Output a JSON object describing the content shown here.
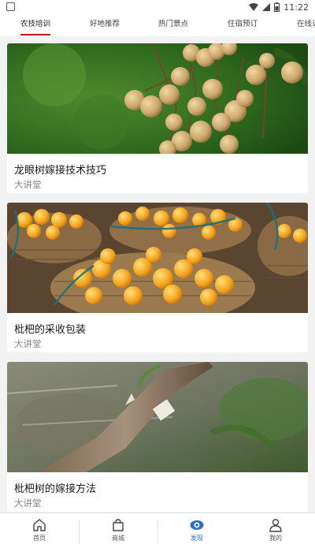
{
  "status_bar": {
    "time": "11:22"
  },
  "tabs": [
    {
      "label": "农技培训",
      "active": true
    },
    {
      "label": "好地推荐",
      "active": false
    },
    {
      "label": "热门景点",
      "active": false
    },
    {
      "label": "住宿预订",
      "active": false
    },
    {
      "label": "在线订",
      "active": false
    }
  ],
  "cards": [
    {
      "title": "龙眼树嫁接技术技巧",
      "subtitle": "大讲堂",
      "image": "longan-fruit-cluster"
    },
    {
      "title": "枇杷的采收包装",
      "subtitle": "大讲堂",
      "image": "loquat-baskets"
    },
    {
      "title": "枇杷树的嫁接方法",
      "subtitle": "大讲堂",
      "image": "grafted-branch"
    }
  ],
  "bottom_nav": [
    {
      "label": "首页",
      "icon": "home-icon",
      "active": false
    },
    {
      "label": "商城",
      "icon": "shopping-bag-icon",
      "active": false
    },
    {
      "label": "发现",
      "icon": "discover-eye-icon",
      "active": true
    },
    {
      "label": "我的",
      "icon": "user-icon",
      "active": false
    }
  ],
  "colors": {
    "accent_red": "#c6141d",
    "active_blue": "#2b6fd6"
  }
}
